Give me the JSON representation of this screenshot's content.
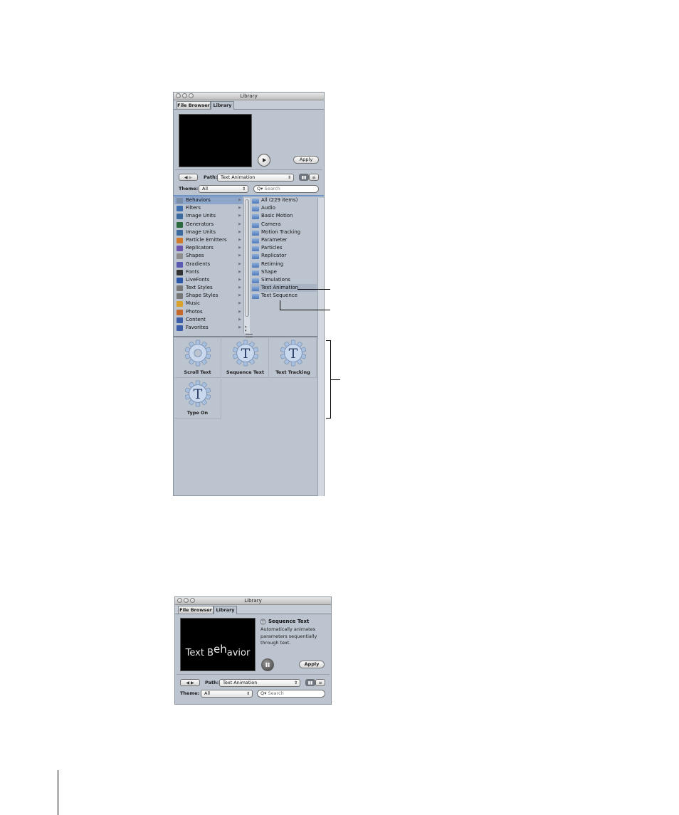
{
  "window1": {
    "title": "Library",
    "tabs": [
      "File Browser",
      "Library"
    ],
    "apply_label": "Apply",
    "path_label": "Path:",
    "path_value": "Text Animation",
    "theme_label": "Theme:",
    "theme_value": "All",
    "search_placeholder": "Search",
    "categories": [
      {
        "label": "Behaviors",
        "icon": "gear-icon"
      },
      {
        "label": "Filters",
        "icon": "filter-icon"
      },
      {
        "label": "Image Units",
        "icon": "image-units-icon"
      },
      {
        "label": "Generators",
        "icon": "generator-icon"
      },
      {
        "label": "Image Units",
        "icon": "image-units-icon"
      },
      {
        "label": "Particle Emitters",
        "icon": "particle-icon"
      },
      {
        "label": "Replicators",
        "icon": "replicator-icon"
      },
      {
        "label": "Shapes",
        "icon": "shape-icon"
      },
      {
        "label": "Gradients",
        "icon": "gradient-icon"
      },
      {
        "label": "Fonts",
        "icon": "font-icon"
      },
      {
        "label": "LiveFonts",
        "icon": "livefont-icon"
      },
      {
        "label": "Text Styles",
        "icon": "text-style-icon"
      },
      {
        "label": "Shape Styles",
        "icon": "shape-style-icon"
      },
      {
        "label": "Music",
        "icon": "music-icon"
      },
      {
        "label": "Photos",
        "icon": "photos-icon"
      },
      {
        "label": "Content",
        "icon": "content-icon"
      },
      {
        "label": "Favorites",
        "icon": "favorites-icon"
      }
    ],
    "subcategories": [
      "All (229 items)",
      "Audio",
      "Basic Motion",
      "Camera",
      "Motion Tracking",
      "Parameter",
      "Particles",
      "Replicator",
      "Retiming",
      "Shape",
      "Simulations",
      "Text Animation",
      "Text Sequence"
    ],
    "items": [
      "Scroll Text",
      "Sequence Text",
      "Text Tracking",
      "Type On"
    ]
  },
  "window2": {
    "title": "Library",
    "tabs": [
      "File Browser",
      "Library"
    ],
    "preview_text_a": "Text B",
    "preview_text_b": "eh",
    "preview_text_c": "avior",
    "item_title": "Sequence Text",
    "item_description": "Automatically animates parameters sequentially through text.",
    "apply_label": "Apply",
    "path_label": "Path:",
    "path_value": "Text Animation",
    "theme_label": "Theme:",
    "theme_value": "All",
    "search_placeholder": "Search"
  },
  "colors": {
    "panel": "#bcc4d0",
    "selection": "#8ea6c9",
    "folder": "#4f78b8"
  }
}
